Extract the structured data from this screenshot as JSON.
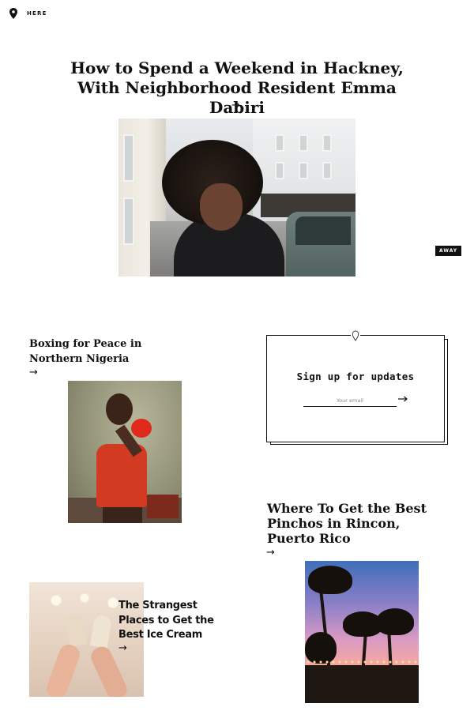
{
  "header": {
    "brand": "HERE",
    "icon": "map-pin-icon"
  },
  "hero": {
    "title": "How to Spend a Weekend in Hackney, With Neighborhood Resident Emma Dabiri",
    "arrow": "→",
    "image": "woman-portrait-street-photo"
  },
  "away_tag": "AWAY",
  "stories": {
    "boxing": {
      "title": "Boxing for Peace in Northern Nigeria",
      "arrow": "→",
      "image": "young-boxer-red-gloves-photo"
    },
    "pinchos": {
      "title": "Where To Get the Best Pinchos in Rincon, Puerto Rico",
      "arrow": "→",
      "image": "palm-trees-sunset-photo"
    },
    "icecream": {
      "title": "The Strangest Places to Get the Best Ice Cream",
      "arrow": "→",
      "image": "ice-cream-cones-hands-photo"
    }
  },
  "signup": {
    "heading": "Sign up for updates",
    "email_placeholder": "Your email",
    "email_value": "",
    "submit_icon": "arrow-right-icon",
    "submit_arrow": "⟶",
    "accent": "#111111"
  }
}
